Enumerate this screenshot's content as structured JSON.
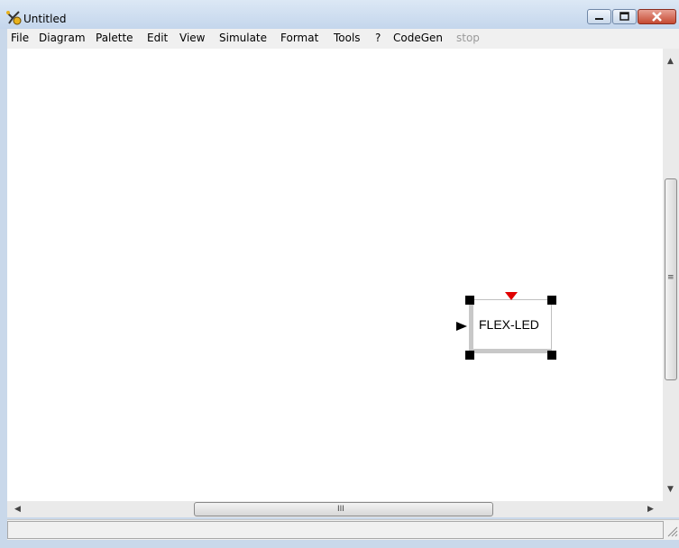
{
  "window": {
    "title": "Untitled",
    "icon": "scicos-app-icon"
  },
  "titlebar_buttons": {
    "minimize": "minimize-icon",
    "maximize": "maximize-icon",
    "close": "close-icon"
  },
  "menubar": {
    "items": [
      "File",
      "Diagram",
      "Palette",
      "Edit",
      "View",
      "Simulate",
      "Format",
      "Tools",
      "?",
      "CodeGen",
      "stop"
    ],
    "disabled": [
      "stop"
    ]
  },
  "diagram": {
    "blocks": [
      {
        "label": "FLEX-LED",
        "selected": true
      }
    ]
  },
  "scrollbars": {
    "horizontal_grip": "III",
    "vertical_grip": "≡"
  },
  "statusbar": {
    "text": ""
  },
  "colors": {
    "titlebar": "#c4d6ec",
    "event_port": "#e00000",
    "canvas": "#ffffff"
  }
}
